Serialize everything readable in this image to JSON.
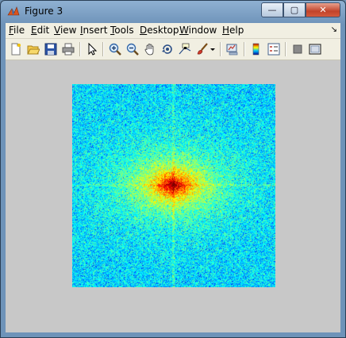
{
  "window": {
    "title": "Figure 3",
    "buttons": {
      "minimize": "—",
      "maximize": "▢",
      "close": "✕"
    }
  },
  "menubar": {
    "items": [
      {
        "label": "File",
        "key": "F"
      },
      {
        "label": "Edit",
        "key": "E"
      },
      {
        "label": "View",
        "key": "V"
      },
      {
        "label": "Insert",
        "key": "I"
      },
      {
        "label": "Tools",
        "key": "T"
      },
      {
        "label": "Desktop",
        "key": "D"
      },
      {
        "label": "Window",
        "key": "W"
      },
      {
        "label": "Help",
        "key": "H"
      }
    ],
    "dock_arrow": "↘"
  },
  "toolbar": {
    "icons": [
      "new-figure-icon",
      "open-file-icon",
      "save-figure-icon",
      "print-figure-icon",
      "edit-plot-icon",
      "zoom-in-icon",
      "zoom-out-icon",
      "pan-icon",
      "rotate-3d-icon",
      "data-cursor-icon",
      "brush-icon",
      "brush-dropdown-icon",
      "link-plot-icon",
      "insert-colorbar-icon",
      "insert-legend-icon",
      "hide-plot-tools-icon",
      "show-plot-tools-icon"
    ]
  },
  "figure": {
    "content": "fft-magnitude-spectrum-image",
    "background": "#c8c8c8",
    "colormap": "jet"
  },
  "colors": {
    "titlebar": "#7aa0c6",
    "menubar": "#f1efe2",
    "figure_bg": "#c8c8c8",
    "close_button": "#c2432a"
  }
}
